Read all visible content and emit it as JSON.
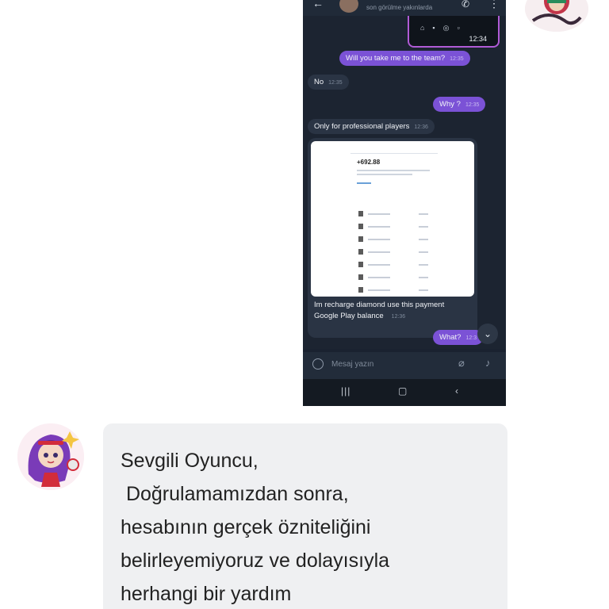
{
  "phone": {
    "header": {
      "back_icon": "arrow-left-icon",
      "status": "son görülme yakınlarda",
      "call_icon": "phone-icon",
      "more_icon": "more-vertical-icon"
    },
    "mini_screenshot": {
      "time": "12:34"
    },
    "messages": [
      {
        "text": "Will you take me to the team?",
        "time": "12:35",
        "direction": "out"
      },
      {
        "text": "No",
        "time": "12:35",
        "direction": "in"
      },
      {
        "text": "Why ?",
        "time": "12:35",
        "direction": "out"
      },
      {
        "text": "Only for professional players",
        "time": "12:36",
        "direction": "in"
      }
    ],
    "image_message": {
      "amount": "+692.88",
      "caption_line1": "Im recharge diamond use this payment",
      "caption_line2": "Google Play balance",
      "time": "12:36"
    },
    "last_message": {
      "text": "What?",
      "time": "12:3",
      "direction": "out"
    },
    "input_placeholder": "Mesaj yazın",
    "colors": {
      "outgoing": "#7b52d6",
      "incoming": "#2a3444",
      "background": "#1c2431"
    }
  },
  "reply": {
    "text": "Sevgili Oyuncu,\n Doğrulamamızdan sonra,\nhesabının gerçek özniteliğini\nbelirleyemiyoruz ve dolayısıyla\nherhangi bir yardım"
  }
}
